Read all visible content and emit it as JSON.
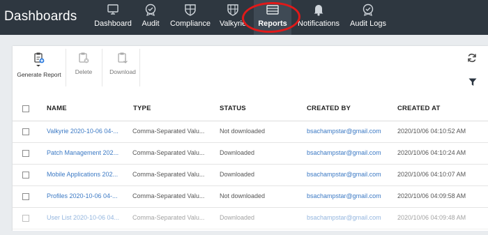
{
  "brand": "Dashboards",
  "nav": [
    {
      "label": "Dashboard",
      "icon": "monitor-icon"
    },
    {
      "label": "Audit",
      "icon": "audit-badge-icon"
    },
    {
      "label": "Compliance",
      "icon": "shield-grid-icon"
    },
    {
      "label": "Valkyrie",
      "icon": "shield-grid-icon"
    },
    {
      "label": "Reports",
      "icon": "tray-icon",
      "active": true
    },
    {
      "label": "Notifications",
      "icon": "bell-icon"
    },
    {
      "label": "Audit Logs",
      "icon": "audit-badge-icon"
    }
  ],
  "toolbar": {
    "generate": "Generate Report",
    "delete": "Delete",
    "download": "Download"
  },
  "table": {
    "headers": {
      "name": "NAME",
      "type": "TYPE",
      "status": "STATUS",
      "created_by": "CREATED BY",
      "created_at": "CREATED AT"
    },
    "rows": [
      {
        "name": "Valkyrie 2020-10-06 04-...",
        "type": "Comma-Separated Valu...",
        "status": "Not downloaded",
        "created_by": "bsachampstar@gmail.com",
        "created_at": "2020/10/06 04:10:52 AM"
      },
      {
        "name": "Patch Management 202...",
        "type": "Comma-Separated Valu...",
        "status": "Downloaded",
        "created_by": "bsachampstar@gmail.com",
        "created_at": "2020/10/06 04:10:24 AM"
      },
      {
        "name": "Mobile Applications 202...",
        "type": "Comma-Separated Valu...",
        "status": "Downloaded",
        "created_by": "bsachampstar@gmail.com",
        "created_at": "2020/10/06 04:10:07 AM"
      },
      {
        "name": "Profiles 2020-10-06 04-...",
        "type": "Comma-Separated Valu...",
        "status": "Not downloaded",
        "created_by": "bsachampstar@gmail.com",
        "created_at": "2020/10/06 04:09:58 AM"
      },
      {
        "name": "User List 2020-10-06 04...",
        "type": "Comma-Separated Valu...",
        "status": "Downloaded",
        "created_by": "bsachampstar@gmail.com",
        "created_at": "2020/10/06 04:09:48 AM"
      }
    ]
  },
  "colors": {
    "topbar": "#2e3740",
    "link": "#3b79c4",
    "highlight": "#e11919"
  }
}
